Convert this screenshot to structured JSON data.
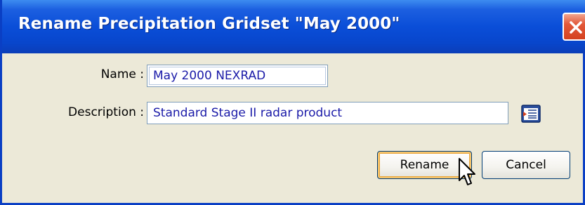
{
  "window": {
    "title": "Rename Precipitation Gridset \"May 2000\""
  },
  "form": {
    "name_label": "Name :",
    "name_value": "May 2000 NEXRAD",
    "description_label": "Description :",
    "description_value": "Standard Stage II radar product"
  },
  "buttons": {
    "rename_label": "Rename",
    "cancel_label": "Cancel"
  },
  "icons": {
    "close": "close-icon",
    "description_browse": "notes-browse-icon",
    "cursor": "mouse-pointer-icon"
  },
  "colors": {
    "titlebar": "#0a4ed8",
    "close_button": "#e2583a",
    "dialog_background": "#ece9d8",
    "field_text": "#1a1aa8",
    "default_button_highlight": "#f5c46b"
  }
}
